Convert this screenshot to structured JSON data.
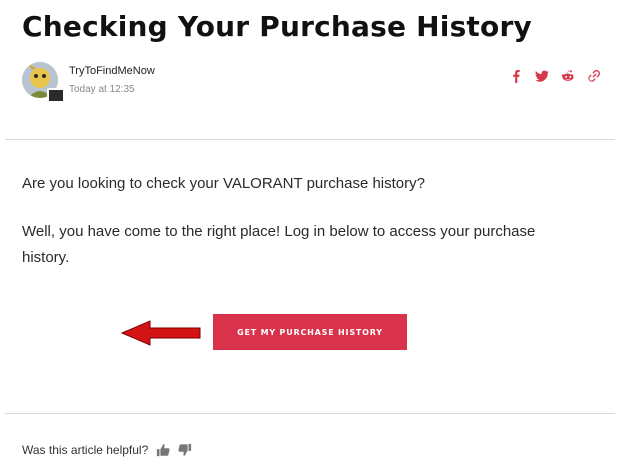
{
  "article": {
    "title": "Checking Your Purchase History",
    "author": "TryToFindMeNow",
    "timestamp": "Today at 12:35",
    "share_icons": [
      "facebook-icon",
      "twitter-icon",
      "reddit-icon",
      "link-icon"
    ],
    "paragraph_1": "Are you looking to check your VALORANT purchase history?",
    "paragraph_2": "Well, you have come to the right place! Log in below to access your purchase history.",
    "cta_label": "GET MY PURCHASE HISTORY"
  },
  "feedback": {
    "question": "Was this article helpful?"
  },
  "colors": {
    "accent": "#d8334a",
    "arrow": "#e01010"
  }
}
